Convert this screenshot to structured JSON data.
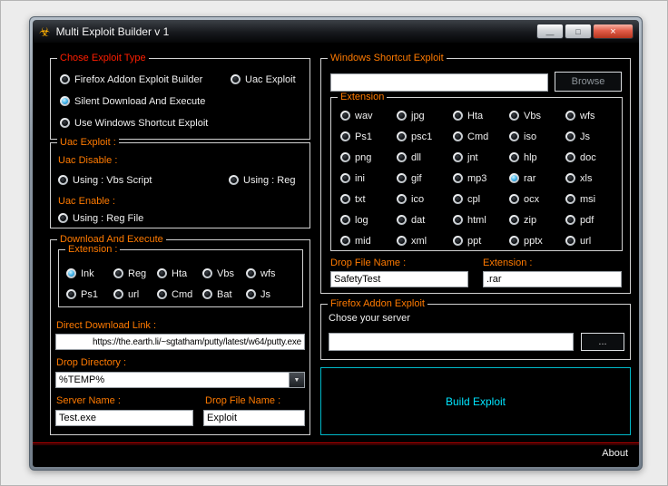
{
  "window": {
    "title": "Multi Exploit Builder v 1"
  },
  "icons": {
    "biohazard": "☣",
    "minimize": "—",
    "maximize": "□",
    "close": "×",
    "dropdown": "▼"
  },
  "colors": {
    "accent_orange": "#ff7a00",
    "accent_red": "#ff1e00",
    "build_cyan": "#00e5ff",
    "build_border": "#00b8c8",
    "radio_selected": "#3fb0e8",
    "separator_red": "#d40000",
    "client_bg": "#000000"
  },
  "exploit_type": {
    "title": "Chose Exploit Type",
    "options": [
      {
        "label": "Firefox Addon Exploit Builder",
        "selected": false
      },
      {
        "label": "Uac Exploit",
        "selected": false
      },
      {
        "label": "Silent Download And Execute",
        "selected": true
      },
      {
        "label": "Use Windows Shortcut Exploit",
        "selected": false
      }
    ]
  },
  "uac_exploit": {
    "title": "Uac Exploit :",
    "disable_label": "Uac Disable :",
    "disable_options": [
      {
        "label": "Using : Vbs Script",
        "selected": false
      },
      {
        "label": "Using : Reg",
        "selected": false
      }
    ],
    "enable_label": "Uac Enable :",
    "enable_options": [
      {
        "label": "Using : Reg File",
        "selected": false
      }
    ]
  },
  "download_execute": {
    "title": "Download And Execute",
    "extension_group": {
      "title": "Extension :",
      "options": [
        {
          "label": "Ink",
          "selected": true
        },
        {
          "label": "Reg",
          "selected": false
        },
        {
          "label": "Hta",
          "selected": false
        },
        {
          "label": "Vbs",
          "selected": false
        },
        {
          "label": "wfs",
          "selected": false
        },
        {
          "label": "Ps1",
          "selected": false
        },
        {
          "label": "url",
          "selected": false
        },
        {
          "label": "Cmd",
          "selected": false
        },
        {
          "label": "Bat",
          "selected": false
        },
        {
          "label": "Js",
          "selected": false
        }
      ]
    },
    "direct_link_label": "Direct Download Link :",
    "direct_link_value": "https://the.earth.li/~sgtatham/putty/latest/w64/putty.exe",
    "drop_directory_label": "Drop Directory :",
    "drop_directory_value": "%TEMP%",
    "server_name_label": "Server Name :",
    "server_name_value": "Test.exe",
    "drop_file_label": "Drop File Name :",
    "drop_file_value": "Exploit"
  },
  "shortcut_exploit": {
    "title": "Windows Shortcut Exploit",
    "file_value": "",
    "browse_label": "Browse",
    "extension_group": {
      "title": "Extension",
      "options": [
        {
          "label": "wav",
          "selected": false
        },
        {
          "label": "jpg",
          "selected": false
        },
        {
          "label": "Hta",
          "selected": false
        },
        {
          "label": "Vbs",
          "selected": false
        },
        {
          "label": "wfs",
          "selected": false
        },
        {
          "label": "Ps1",
          "selected": false
        },
        {
          "label": "psc1",
          "selected": false
        },
        {
          "label": "Cmd",
          "selected": false
        },
        {
          "label": "iso",
          "selected": false
        },
        {
          "label": "Js",
          "selected": false
        },
        {
          "label": "png",
          "selected": false
        },
        {
          "label": "dll",
          "selected": false
        },
        {
          "label": "jnt",
          "selected": false
        },
        {
          "label": "hlp",
          "selected": false
        },
        {
          "label": "doc",
          "selected": false
        },
        {
          "label": "ini",
          "selected": false
        },
        {
          "label": "gif",
          "selected": false
        },
        {
          "label": "mp3",
          "selected": false
        },
        {
          "label": "rar",
          "selected": true
        },
        {
          "label": "xls",
          "selected": false
        },
        {
          "label": "txt",
          "selected": false
        },
        {
          "label": "ico",
          "selected": false
        },
        {
          "label": "cpl",
          "selected": false
        },
        {
          "label": "ocx",
          "selected": false
        },
        {
          "label": "msi",
          "selected": false
        },
        {
          "label": "log",
          "selected": false
        },
        {
          "label": "dat",
          "selected": false
        },
        {
          "label": "html",
          "selected": false
        },
        {
          "label": "zip",
          "selected": false
        },
        {
          "label": "pdf",
          "selected": false
        },
        {
          "label": "mid",
          "selected": false
        },
        {
          "label": "xml",
          "selected": false
        },
        {
          "label": "ppt",
          "selected": false
        },
        {
          "label": "pptx",
          "selected": false
        },
        {
          "label": "url",
          "selected": false
        }
      ]
    },
    "drop_file_label": "Drop File Name :",
    "drop_file_value": "SafetyTest",
    "extension_label": "Extension :",
    "extension_value": ".rar"
  },
  "firefox_exploit": {
    "title": "Firefox Addon Exploit",
    "server_label": "Chose your server",
    "server_value": "",
    "browse_label": "..."
  },
  "build_button_label": "Build Exploit",
  "footer": {
    "about_label": "About"
  }
}
